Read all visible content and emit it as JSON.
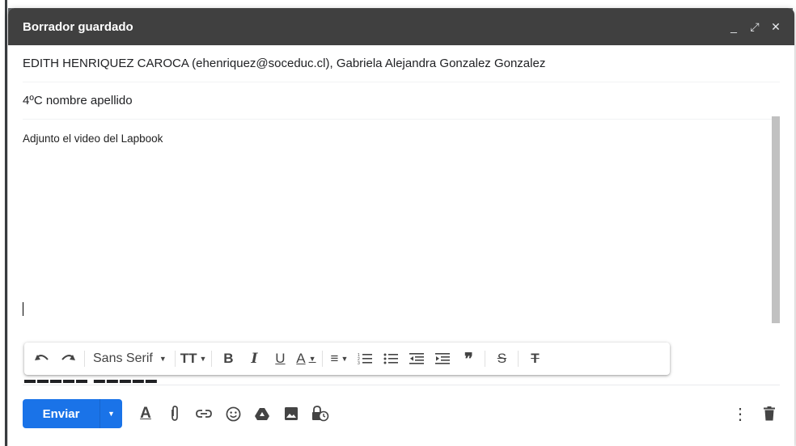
{
  "compose": {
    "title": "Borrador guardado",
    "controls": {
      "minimize": "_",
      "expand": "⤢",
      "close": "✕"
    },
    "recipients": "EDITH HENRIQUEZ CAROCA (ehenriquez@soceduc.cl), Gabriela Alejandra Gonzalez Gonzalez",
    "subject": "4ºC nombre apellido",
    "body": "Adjunto el video del Lapbook"
  },
  "format_toolbar": {
    "font_name": "Sans Serif",
    "icons": [
      "undo-icon",
      "redo-icon",
      "font-size-icon",
      "bold-icon",
      "italic-icon",
      "underline-icon",
      "text-color-icon",
      "align-icon",
      "numbered-list-icon",
      "bulleted-list-icon",
      "indent-less-icon",
      "indent-more-icon",
      "quote-icon",
      "strikethrough-icon",
      "remove-formatting-icon"
    ]
  },
  "bottom_bar": {
    "send_label": "Enviar",
    "icons": [
      "formatting-options-icon",
      "attach-icon",
      "link-icon",
      "emoji-icon",
      "drive-icon",
      "photo-icon",
      "confidential-icon",
      "more-options-icon",
      "discard-icon"
    ]
  },
  "colors": {
    "titlebar": "#404040",
    "send_button": "#1a73e8"
  }
}
